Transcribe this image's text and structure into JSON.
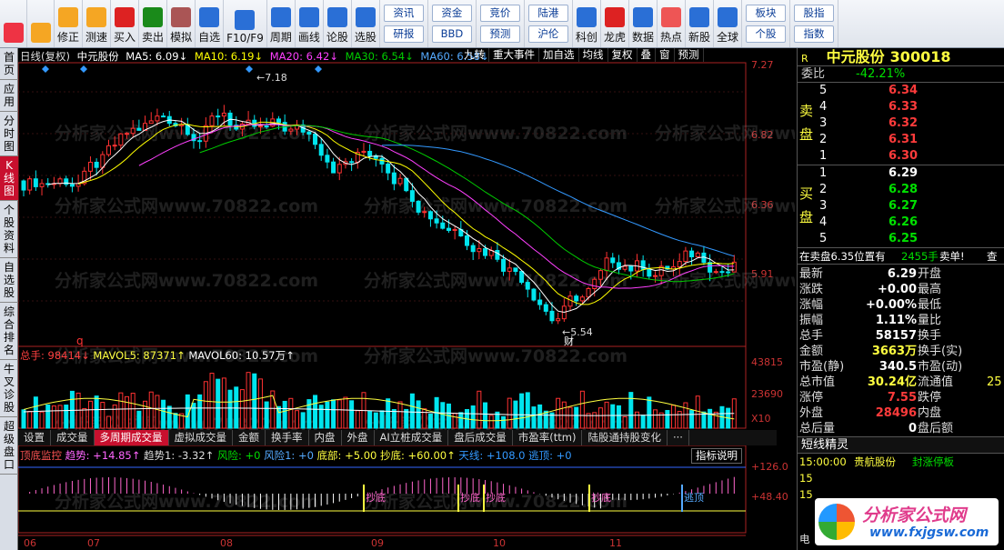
{
  "toolbar": {
    "buttons": [
      {
        "label": "",
        "icon": "windows-icon"
      },
      {
        "label": "",
        "icon": "back-arrow-icon"
      },
      {
        "label": "修正",
        "icon": "up-arrow-icon"
      },
      {
        "label": "测速",
        "icon": "clock-icon"
      },
      {
        "label": "买入",
        "icon": "buy-icon"
      },
      {
        "label": "卖出",
        "icon": "sell-icon"
      },
      {
        "label": "模拟",
        "icon": "hammer-icon"
      },
      {
        "label": "自选",
        "icon": "star-icon"
      },
      {
        "label": "F10/F9",
        "icon": "f10-icon"
      },
      {
        "label": "周期",
        "icon": "period-icon"
      },
      {
        "label": "画线",
        "icon": "pen-icon"
      },
      {
        "label": "论股",
        "icon": "discuss-icon"
      },
      {
        "label": "选股",
        "icon": "search-icon"
      }
    ],
    "grp1": [
      "资讯",
      "研报"
    ],
    "grp2": [
      "资金",
      "BBD"
    ],
    "grp3": [
      "竞价",
      "预测"
    ],
    "grp4": [
      "陆港",
      "沪伦"
    ],
    "buttons2": [
      {
        "label": "科创",
        "icon": "chart-icon"
      },
      {
        "label": "龙虎",
        "icon": "dragon-icon"
      },
      {
        "label": "数据",
        "icon": "pe-icon"
      },
      {
        "label": "热点",
        "icon": "fire-icon"
      },
      {
        "label": "新股",
        "icon": "ipo-icon"
      },
      {
        "label": "全球",
        "icon": "globe-icon"
      }
    ],
    "grp5": [
      "板块",
      "个股"
    ],
    "grp6": [
      "股指",
      "指数"
    ]
  },
  "left_tabs": [
    "首页",
    "应用",
    "分时图",
    "K线图",
    "个股资料",
    "自选股",
    "综合排名",
    "牛叉诊股",
    "超级盘口"
  ],
  "kline": {
    "period": "日线(复权)",
    "name": "中元股份",
    "ma5": "MA5: 6.09↓",
    "ma10": "MA10: 6.19↓",
    "ma20": "MA20: 6.42↓",
    "ma30": "MA30: 6.54↓",
    "ma60": "MA60: 6.58↓",
    "buttons": [
      "九转",
      "重大事件",
      "加自选",
      "均线",
      "复权",
      "叠",
      "窗",
      "预测"
    ],
    "price_axis": [
      "7.27",
      "6.82",
      "6.36",
      "5.91"
    ],
    "hi_label": "7.18",
    "lo_label": "5.54",
    "cai": "财",
    "q": "q",
    "ma_colors": {
      "ma5": "#ffffff",
      "ma10": "#ffff00",
      "ma20": "#ff40ff",
      "ma30": "#00cc00",
      "ma60": "#3399ff"
    }
  },
  "volume": {
    "zongshou": "总手: 98414↓",
    "mavol5": "MAVOL5: 87371↑",
    "mavol60": "MAVOL60: 10.57万↑",
    "axis": [
      "43815",
      "23690",
      "X10"
    ]
  },
  "tabs": [
    "设置",
    "成交量",
    "多周期成交量",
    "虚拟成交量",
    "金额",
    "换手率",
    "内盘",
    "外盘",
    "AI立桩成交量",
    "盘后成交量",
    "市盈率(ttm)",
    "陆股通持股变化",
    "···"
  ],
  "active_tab": "多周期成交量",
  "indicator": {
    "name": "顶底监控",
    "qushi": "趋势: +14.85↑",
    "qushi1": "趋势1: -3.32↑",
    "fengxian": "风险: +0",
    "fengxian1": "风险1: +0",
    "dibu": "底部: +5.00",
    "chaodi": "抄底: +60.00↑",
    "tianxian": "天线: +108.0",
    "taoding": "逃顶: +0",
    "help": "指标说明",
    "axis": [
      "+126.0",
      "+48.40"
    ],
    "marks": [
      "抄底",
      "抄底",
      "抄底",
      "抄底",
      "逃顶"
    ]
  },
  "xaxis": [
    "06",
    "07",
    "08",
    "09",
    "10",
    "11"
  ],
  "quote": {
    "r": "R",
    "name": "中元股份",
    "code": "300018",
    "weibi_label": "委比",
    "weibi": "-42.21%",
    "sell_label": "卖盘",
    "buy_label": "买盘",
    "sell": [
      [
        "5",
        "6.34"
      ],
      [
        "4",
        "6.33"
      ],
      [
        "3",
        "6.32"
      ],
      [
        "2",
        "6.31"
      ],
      [
        "1",
        "6.30"
      ]
    ],
    "buy": [
      [
        "1",
        "6.29"
      ],
      [
        "2",
        "6.28"
      ],
      [
        "3",
        "6.27"
      ],
      [
        "4",
        "6.26"
      ],
      [
        "5",
        "6.25"
      ]
    ],
    "order_note": "在卖盘6.35位置有",
    "order_qty": "2455手",
    "order_type": "卖单!",
    "order_more": "查",
    "stats": [
      [
        "最新",
        "6.29",
        "开盘",
        ""
      ],
      [
        "涨跌",
        "+0.00",
        "最高",
        ""
      ],
      [
        "涨幅",
        "+0.00%",
        "最低",
        ""
      ],
      [
        "振幅",
        "1.11%",
        "量比",
        ""
      ],
      [
        "总手",
        "58157",
        "换手",
        ""
      ],
      [
        "金额",
        "3663万",
        "换手(实)",
        ""
      ],
      [
        "市盈(静)",
        "340.5",
        "市盈(动)",
        ""
      ],
      [
        "总市值",
        "30.24亿",
        "流通值",
        "25"
      ],
      [
        "涨停",
        "7.55",
        "跌停",
        ""
      ],
      [
        "外盘",
        "28496",
        "内盘",
        ""
      ],
      [
        "总后量",
        "0",
        "盘后额",
        ""
      ]
    ],
    "short_title": "短线精灵",
    "short_rows": [
      [
        "15:00:00",
        "贵航股份",
        "封涨停板"
      ],
      [
        "15",
        "",
        " "
      ],
      [
        "15",
        "",
        ""
      ],
      [
        "",
        "",
        " "
      ]
    ],
    "short_more": "电"
  },
  "watermark": "分析家公式网www.70822.com",
  "brand": {
    "name": "分析家公式网",
    "url": "www.fxjgsw.com"
  }
}
